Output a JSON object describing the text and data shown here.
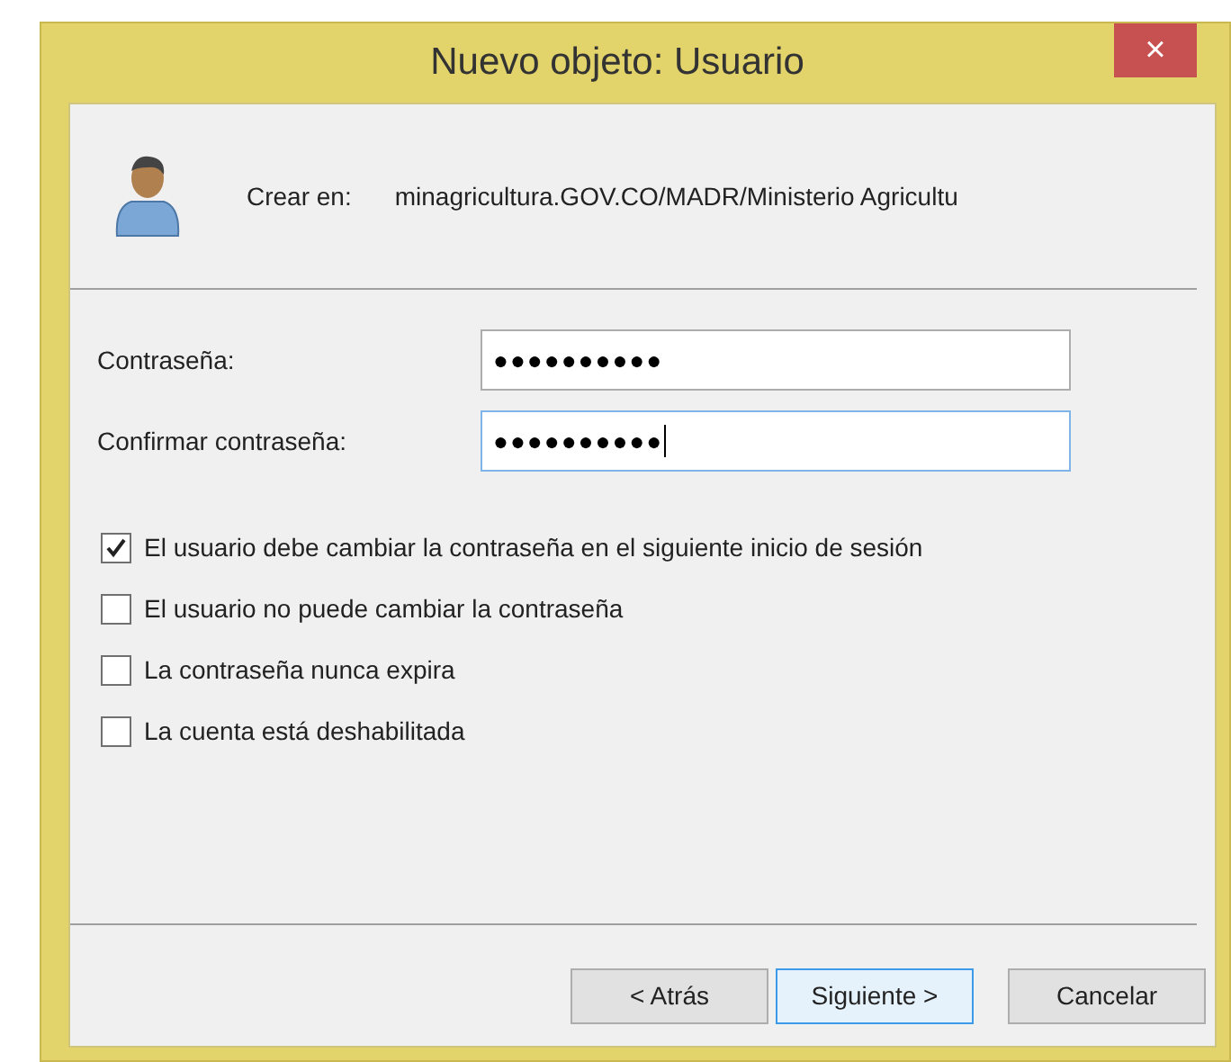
{
  "window": {
    "title": "Nuevo objeto: Usuario",
    "close": "×"
  },
  "create_in": {
    "label": "Crear en:",
    "path": "minagricultura.GOV.CO/MADR/Ministerio Agricultu"
  },
  "fields": [
    {
      "label": "Contraseña:",
      "value": "●●●●●●●●●●",
      "focused": false
    },
    {
      "label": "Confirmar contraseña:",
      "value": "●●●●●●●●●●",
      "focused": true
    }
  ],
  "options": [
    {
      "label": "El usuario debe cambiar la contraseña en el siguiente inicio de sesión",
      "checked": true
    },
    {
      "label": "El usuario no puede cambiar la contraseña",
      "checked": false
    },
    {
      "label": "La contraseña nunca expira",
      "checked": false
    },
    {
      "label": "La cuenta está deshabilitada",
      "checked": false
    }
  ],
  "buttons": [
    {
      "label": "< Atrás",
      "default": false
    },
    {
      "label": "Siguiente >",
      "default": true
    },
    {
      "label": "Cancelar",
      "default": false
    }
  ]
}
